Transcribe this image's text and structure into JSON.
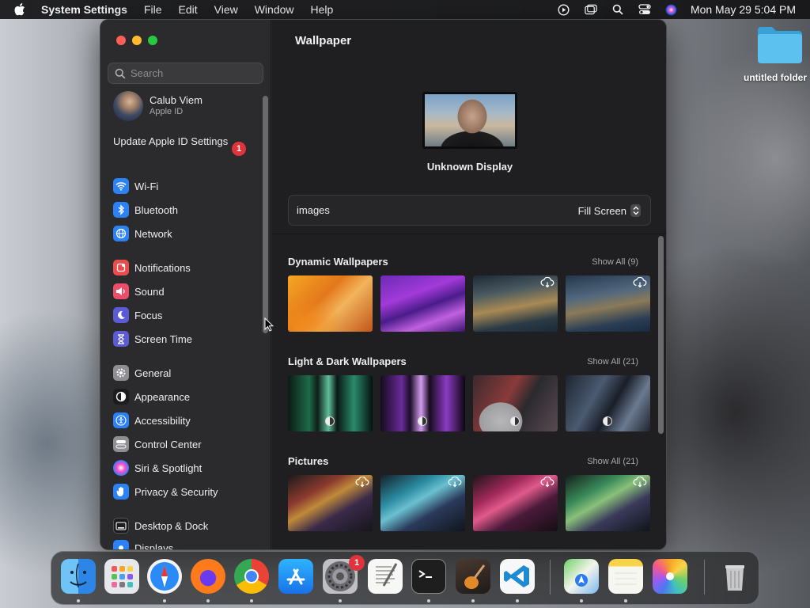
{
  "menubar": {
    "app_name": "System Settings",
    "items": [
      "File",
      "Edit",
      "View",
      "Window",
      "Help"
    ],
    "clock": "Mon May 29  5:04 PM",
    "icons": [
      "apple-icon",
      "play-circle-icon",
      "window-icon",
      "search-icon",
      "control-center-icon",
      "siri-icon"
    ]
  },
  "desktop": {
    "folder_label": "untitled folder"
  },
  "sidebar": {
    "search_placeholder": "Search",
    "account": {
      "name": "Calub Viem",
      "sub": "Apple ID"
    },
    "update": {
      "label": "Update Apple ID Settings",
      "badge": "1"
    },
    "items": [
      {
        "label": "Wi-Fi",
        "icon": "wifi-icon",
        "color": "#2a82f6"
      },
      {
        "label": "Bluetooth",
        "icon": "bluetooth-icon",
        "color": "#2a82f6"
      },
      {
        "label": "Network",
        "icon": "globe-icon",
        "color": "#2a82f6"
      },
      {
        "label": "Notifications",
        "icon": "bell-icon",
        "color": "#eb4d4f"
      },
      {
        "label": "Sound",
        "icon": "speaker-icon",
        "color": "#eb4d6a"
      },
      {
        "label": "Focus",
        "icon": "moon-icon",
        "color": "#5b5bd6"
      },
      {
        "label": "Screen Time",
        "icon": "hourglass-icon",
        "color": "#5b5bd6"
      },
      {
        "label": "General",
        "icon": "gear-icon",
        "color": "#8e8e93"
      },
      {
        "label": "Appearance",
        "icon": "appearance-icon",
        "color": "#1c1c1e"
      },
      {
        "label": "Accessibility",
        "icon": "accessibility-icon",
        "color": "#2a82f6"
      },
      {
        "label": "Control Center",
        "icon": "control-center-icon",
        "color": "#8e8e93"
      },
      {
        "label": "Siri & Spotlight",
        "icon": "siri-icon",
        "color": "#c04fd6"
      },
      {
        "label": "Privacy & Security",
        "icon": "hand-icon",
        "color": "#2a82f6"
      },
      {
        "label": "Desktop & Dock",
        "icon": "dock-icon",
        "color": "#1c1c1e"
      },
      {
        "label": "Displays",
        "icon": "display-icon",
        "color": "#2a82f6"
      }
    ]
  },
  "main": {
    "title": "Wallpaper",
    "display_name": "Unknown Display",
    "picker": {
      "value": "images",
      "fill_mode": "Fill Screen"
    },
    "sections": [
      {
        "title": "Dynamic Wallpapers",
        "show_all": "Show All (9)"
      },
      {
        "title": "Light & Dark Wallpapers",
        "show_all": "Show All (21)"
      },
      {
        "title": "Pictures",
        "show_all": "Show All (21)"
      }
    ]
  },
  "dock": {
    "apps": [
      "Finder",
      "Launchpad",
      "Safari",
      "Firefox",
      "Chrome",
      "App Store",
      "System Settings",
      "TextEdit",
      "Terminal",
      "GarageBand",
      "Visual Studio Code",
      "Maps",
      "Notes",
      "Photos",
      "Trash"
    ],
    "settings_badge": "1"
  }
}
